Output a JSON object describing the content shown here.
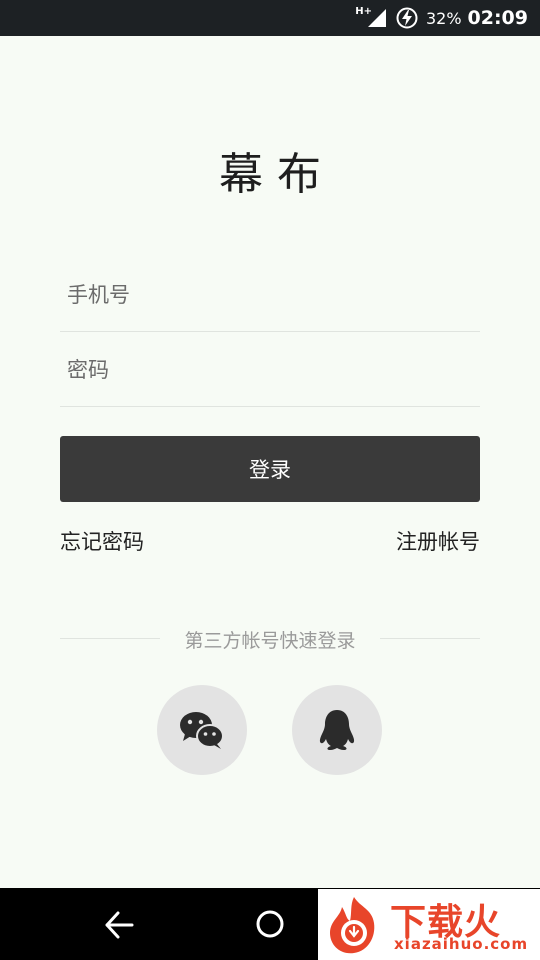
{
  "status_bar": {
    "network": "H+",
    "battery_percent": "32%",
    "time": "02:09",
    "icons": [
      "signal-icon",
      "battery-charging-icon"
    ]
  },
  "app": {
    "title": "幕布"
  },
  "form": {
    "phone_placeholder": "手机号",
    "password_placeholder": "密码",
    "login_label": "登录",
    "forgot_password": "忘记密码",
    "register": "注册帐号"
  },
  "third_party": {
    "label": "第三方帐号快速登录",
    "providers": [
      "wechat-icon",
      "qq-icon"
    ]
  },
  "nav_bar": {
    "icons": [
      "back-icon",
      "home-icon"
    ]
  },
  "watermark": {
    "title": "下载火",
    "url": "xiazaihuo.com"
  },
  "colors": {
    "background": "#f7fbf5",
    "button": "#3a3a3a",
    "status_bar": "#1d2124",
    "watermark": "#e8452a"
  }
}
